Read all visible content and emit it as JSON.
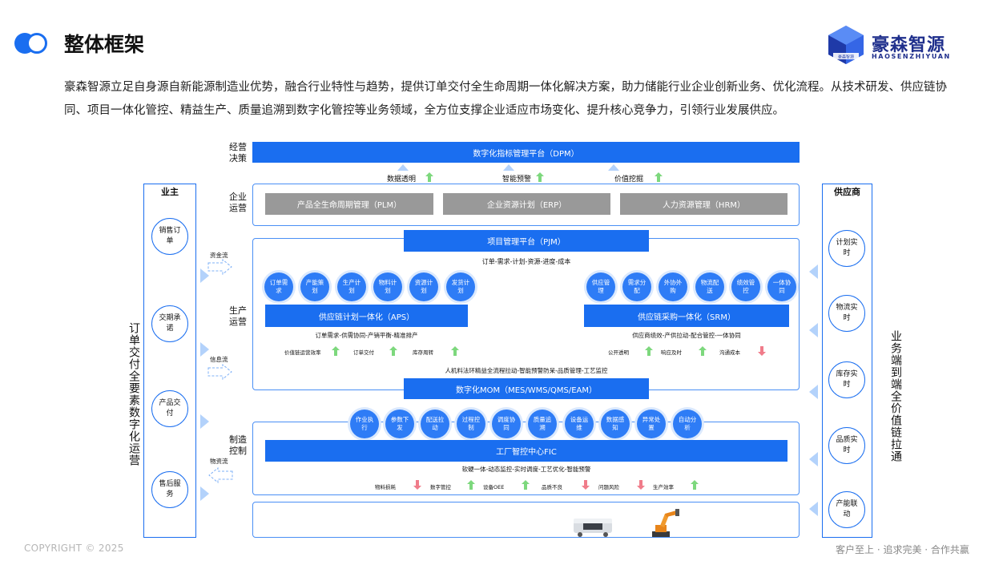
{
  "header": {
    "title": "整体框架",
    "logo_text": "豪森智源",
    "logo_sub": "HAOSENZHIYUAN",
    "logo_badge": "豪森智源"
  },
  "intro": "豪森智源立足自身源自新能源制造业优势，融合行业特性与趋势，提供订单交付全生命周期一体化解决方案，助力储能行业企业创新业务、优化流程。从技术研发、供应链协同、项目一体化管控、精益生产、质量追溯到数字化管控等业务领域，全方位支撑企业适应市场变化、提升核心竞争力，引领行业发展供应。",
  "left_panel": {
    "title": "业主",
    "items": [
      "销售订单",
      "交期承诺",
      "产品交付",
      "售后服务"
    ],
    "vertical_label": "订单交付全要素数字化运营"
  },
  "right_panel": {
    "title": "供应商",
    "items": [
      "计划实时",
      "物流实时",
      "库存实时",
      "品质实时",
      "产能联动"
    ],
    "vertical_label": "业务端到端全价值链拉通"
  },
  "flows": [
    "资金流",
    "信息流",
    "物资流"
  ],
  "layers": {
    "decision": {
      "label": "经营决策",
      "platform": "数字化指标管理平台（DPM）",
      "features": [
        "数据透明",
        "智能预警",
        "价值挖掘"
      ]
    },
    "enterprise": {
      "label": "企业运营",
      "systems": [
        "产品全生命周期管理（PLM）",
        "企业资源计划（ERP）",
        "人力资源管理（HRM）"
      ]
    },
    "production": {
      "label": "生产运营",
      "pjm": "项目管理平台（PJM）",
      "pjm_caption": "订单-需求-计划-资源-进度-成本",
      "aps_nodes": [
        "订单需求",
        "产能策划",
        "生产计划",
        "物料计划",
        "资源计划",
        "发货计划"
      ],
      "srm_nodes": [
        "供应管理",
        "需求分配",
        "外协外购",
        "物流配送",
        "绩效管控",
        "一体协同"
      ],
      "aps": "供应链计划一体化（APS）",
      "srm": "供应链采购一体化（SRM）",
      "aps_caption": "订单需求-供需协同-产销平衡-精准排产",
      "srm_caption": "供应商绩效-产供拉动-配合管控-一体协同",
      "aps_metrics": [
        "价值链运营效率",
        "订单交付",
        "库存周转"
      ],
      "srm_metrics": [
        "公开透明",
        "响应及时",
        "沟通成本"
      ],
      "mom_caption": "人机料法环精益全流程拉动-智能预警防呆-品质管理-工艺监控",
      "mom": "数字化MOM（MES/WMS/QMS/EAM）"
    },
    "manufacturing": {
      "label": "制造控制",
      "nodes": [
        "作业执行",
        "参数下发",
        "配送拉动",
        "过程控制",
        "调度协同",
        "质量追溯",
        "设备运维",
        "数据感知",
        "异常处置",
        "自动分析"
      ],
      "fic": "工厂智控中心FIC",
      "caption": "软硬一体-动态监控-实时调度-工艺优化-智能预警",
      "metrics": [
        "物料损耗",
        "数字管控",
        "设备OEE",
        "品质不良",
        "问题风险",
        "生产效率"
      ]
    }
  },
  "footer": {
    "copyright": "COPYRIGHT © 2025",
    "slogan": "客户至上 · 追求完美 · 合作共赢"
  },
  "colors": {
    "primary": "#1a6ef0",
    "node": "#2e7cf6",
    "gray_bar": "#999999",
    "arrow_up": "#7dd87d",
    "arrow_down": "#f07c8a",
    "logo": "#1f2f8c"
  }
}
